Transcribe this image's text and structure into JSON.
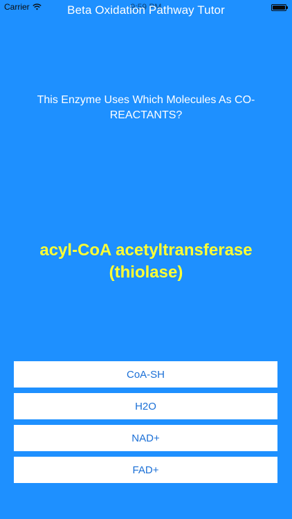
{
  "status_bar": {
    "carrier": "Carrier",
    "time": "9:59 PM",
    "icons": [
      "wifi-icon",
      "battery-icon"
    ]
  },
  "nav": {
    "title": "Beta Oxidation Pathway Tutor"
  },
  "quiz": {
    "question": "This Enzyme Uses Which Molecules As CO-REACTANTS?",
    "enzyme_name": "acyl-CoA acetyltransferase (thiolase)",
    "answers": [
      {
        "label": "CoA-SH"
      },
      {
        "label": "H2O"
      },
      {
        "label": "NAD+"
      },
      {
        "label": "FAD+"
      }
    ]
  },
  "colors": {
    "background": "#1e90ff",
    "enzyme_text": "#ffff33",
    "answer_text": "#1a6fd6",
    "answer_bg": "#ffffff"
  }
}
